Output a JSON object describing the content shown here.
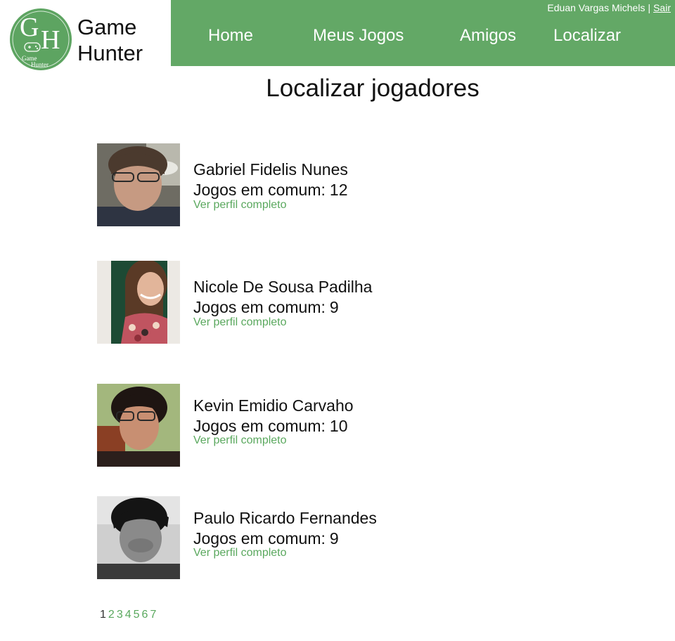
{
  "brand": {
    "monogram_g": "G",
    "monogram_h": "H",
    "badge_text_1": "Game",
    "badge_text_2": "Hunter",
    "line1": "Game",
    "line2": "Hunter",
    "color": "#63a866"
  },
  "userbar": {
    "username": "Eduan Vargas Michels",
    "separator": "|",
    "logout": "Sair"
  },
  "nav": {
    "items": [
      {
        "label": "Home"
      },
      {
        "label": "Meus Jogos"
      },
      {
        "label": "Amigos"
      },
      {
        "label": "Localizar"
      }
    ]
  },
  "page": {
    "title": "Localizar jogadores"
  },
  "players": [
    {
      "name": "Gabriel Fidelis Nunes",
      "common_label": "Jogos em comum:",
      "common_count": "12",
      "link": "Ver perfil completo"
    },
    {
      "name": "Nicole De Sousa Padilha",
      "common_label": "Jogos em comum:",
      "common_count": "9",
      "link": "Ver perfil completo"
    },
    {
      "name": "Kevin Emidio Carvaho",
      "common_label": "Jogos em comum:",
      "common_count": "10",
      "link": "Ver perfil completo"
    },
    {
      "name": "Paulo Ricardo Fernandes",
      "common_label": "Jogos em comum:",
      "common_count": "9",
      "link": "Ver perfil completo"
    }
  ],
  "pagination": {
    "current": "1",
    "pages": [
      "2",
      "3",
      "4",
      "5",
      "6",
      "7"
    ]
  },
  "colors": {
    "accent": "#63a866",
    "link": "#5aa85e"
  }
}
